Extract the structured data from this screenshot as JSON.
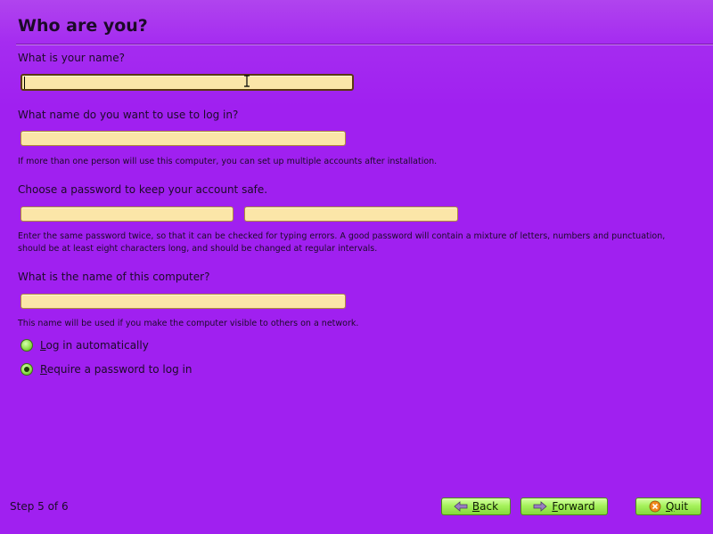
{
  "page": {
    "title": "Who are you?"
  },
  "name_section": {
    "label": "What is your name?",
    "value": ""
  },
  "login_section": {
    "label": "What name do you want to use to log in?",
    "value": "",
    "hint": "If more than one person will use this computer, you can set up multiple accounts after installation."
  },
  "password_section": {
    "label": "Choose a password to keep your account safe.",
    "password_value": "",
    "confirm_value": "",
    "hint_line1": "Enter the same password twice, so that it can be checked for typing errors. A good password will contain a mixture of letters, numbers and punctuation,",
    "hint_line2": "should be at least eight characters long, and should be changed at regular intervals."
  },
  "computer_section": {
    "label": "What is the name of this computer?",
    "value": "",
    "hint": "This name will be used if you make the computer visible to others on a network."
  },
  "login_options": {
    "auto": {
      "mnemonic": "L",
      "rest": "og in automatically",
      "selected": false
    },
    "password": {
      "mnemonic": "R",
      "rest": "equire a password to log in",
      "selected": true
    }
  },
  "footer": {
    "step_text": "Step 5 of 6",
    "back": {
      "mnemonic": "B",
      "rest": "ack",
      "icon": "arrow-left-icon"
    },
    "forward": {
      "mnemonic": "F",
      "rest": "orward",
      "icon": "arrow-right-icon"
    },
    "quit": {
      "mnemonic": "Q",
      "rest": "uit",
      "icon": "cancel-icon"
    }
  },
  "colors": {
    "background": "#a020f0",
    "field": "#fbe6a8",
    "button": "#a6f25c"
  }
}
